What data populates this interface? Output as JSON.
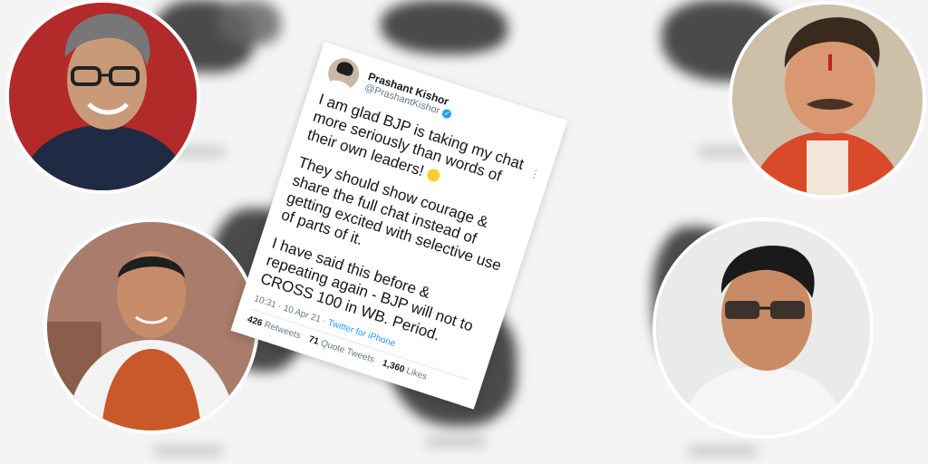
{
  "tweet": {
    "name": "Prashant Kishor",
    "handle": "@PrashantKishor",
    "paragraphs": [
      "I am glad BJP is taking my chat more seriously than words of their own leaders!",
      "They should show courage & share the full chat instead of getting excited with selective use of parts of it.",
      "I have said this before & repeating again - BJP will not to CROSS 100 in WB. Period."
    ],
    "time": "10:31 · 10 Apr 21",
    "source": "Twitter for iPhone",
    "retweets_count": "426",
    "retweets_label": "Retweets",
    "quotes_count": "71",
    "quotes_label": "Quote Tweets",
    "likes_count": "1,360",
    "likes_label": "Likes"
  },
  "portraits": [
    {
      "position": "top-left",
      "bg": "#b32a2a",
      "shirt": "#1f2a44"
    },
    {
      "position": "bottom-left",
      "bg": "#a97c6c",
      "shirt": "#c9592a"
    },
    {
      "position": "top-right",
      "bg": "#cdbfa8",
      "shirt": "#d84a2a"
    },
    {
      "position": "bottom-right",
      "bg": "#e9ebe8",
      "shirt": "#f5f5f5"
    }
  ],
  "icons": [
    "verified-badge-icon",
    "more-options-icon"
  ]
}
